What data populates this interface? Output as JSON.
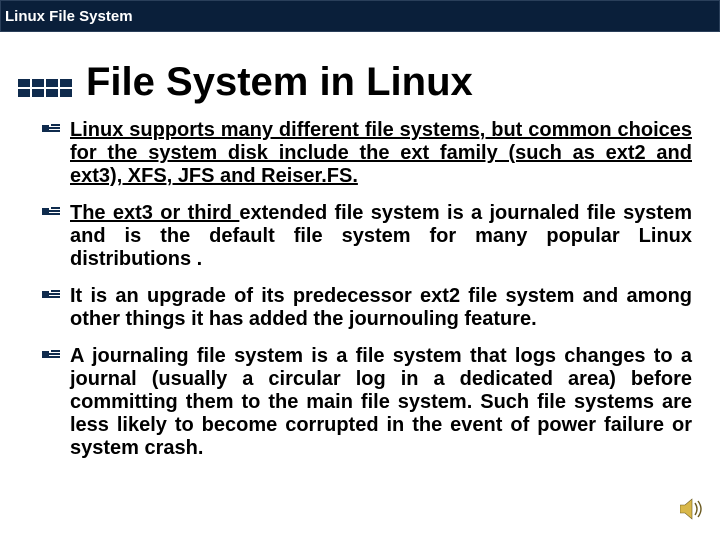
{
  "topbar": {
    "label": "Linux File System"
  },
  "title": "File System in Linux",
  "bullets": {
    "b1_u": "Linux supports many different file systems, but common choices for the system disk include the ext family (such as ext2 and ext3), XFS, JFS and Reiser.FS.",
    "b2_u": "The ext3 or third ",
    "b2_rest": "extended file system is a journaled file system and is the default file system for many popular Linux distributions .",
    "b3": "It is an upgrade of its predecessor ext2 file system and among other things it has added the journouling feature.",
    "b4": "A journaling file system is a file system that logs changes to a journal (usually a circular log in a dedicated area) before committing them to the main file system. Such file systems are less likely to become corrupted in the event of power failure or system crash."
  },
  "icons": {
    "sound": "sound-icon"
  }
}
